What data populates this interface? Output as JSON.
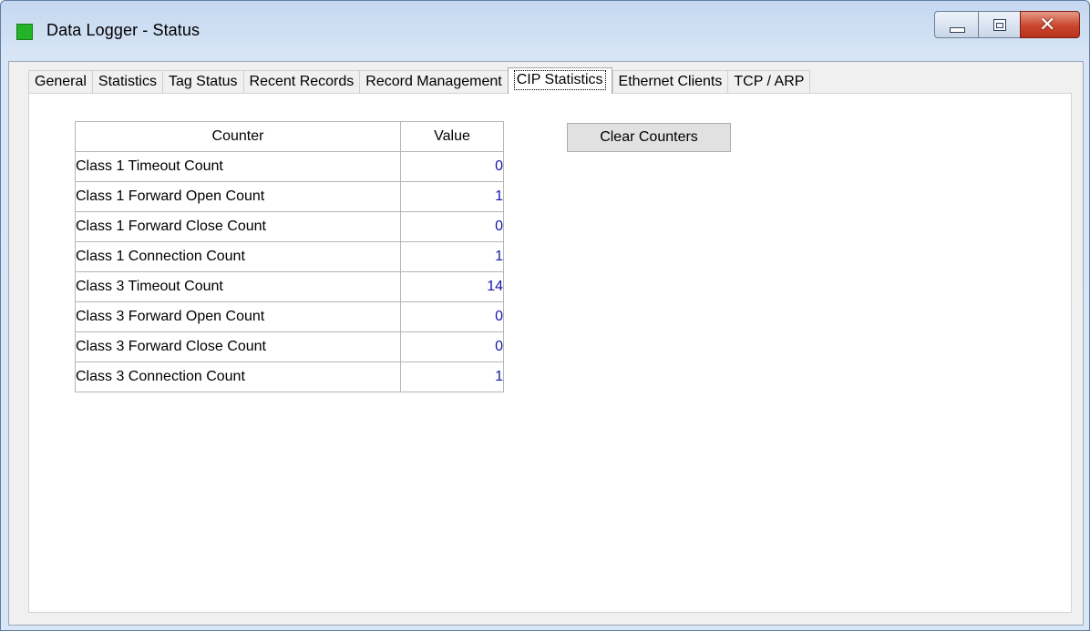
{
  "window": {
    "title": "Data Logger - Status",
    "icon": "green-square-icon",
    "controls": {
      "minimize": "minimize-icon",
      "maximize": "maximize-icon",
      "close": "close-icon",
      "close_glyph": "✕"
    }
  },
  "tabs": [
    {
      "label": "General"
    },
    {
      "label": "Statistics"
    },
    {
      "label": "Tag Status"
    },
    {
      "label": "Recent Records"
    },
    {
      "label": "Record Management"
    },
    {
      "label": "CIP Statistics",
      "active": true
    },
    {
      "label": "Ethernet Clients"
    },
    {
      "label": "TCP / ARP"
    }
  ],
  "table": {
    "headers": {
      "counter": "Counter",
      "value": "Value"
    },
    "rows": [
      {
        "counter": "Class 1 Timeout Count",
        "value": "0"
      },
      {
        "counter": "Class 1 Forward Open Count",
        "value": "1"
      },
      {
        "counter": "Class 1 Forward Close Count",
        "value": "0"
      },
      {
        "counter": "Class 1 Connection Count",
        "value": "1"
      },
      {
        "counter": "Class 3 Timeout Count",
        "value": "14"
      },
      {
        "counter": "Class 3 Forward Open Count",
        "value": "0"
      },
      {
        "counter": "Class 3 Forward Close Count",
        "value": "0"
      },
      {
        "counter": "Class 3 Connection Count",
        "value": "1"
      }
    ]
  },
  "actions": {
    "clear_counters": "Clear Counters"
  },
  "colors": {
    "value_text": "#1515a8",
    "app_icon": "#22b327",
    "close_button": "#c9462d"
  }
}
